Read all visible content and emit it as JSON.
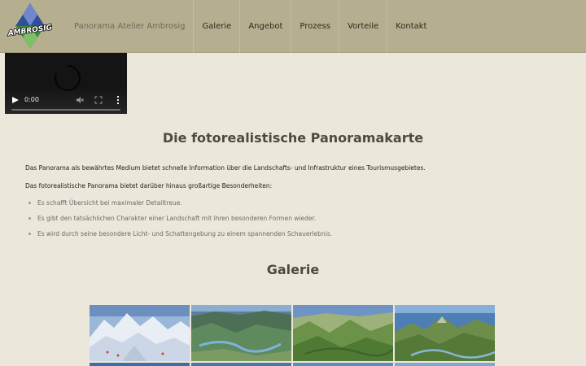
{
  "header": {
    "logo_text": "AMBROSIG",
    "nav": [
      "Panorama Atelier Ambrosig",
      "Galerie",
      "Angebot",
      "Prozess",
      "Vorteile",
      "Kontakt"
    ]
  },
  "video": {
    "time": "0:00",
    "state": "loading"
  },
  "main": {
    "title": "Die fotorealistische Panoramakarte",
    "paragraph1": "Das Panorama als bewährtes Medium bietet schnelle Information über die Landschafts- und Infrastruktur eines Tourismusgebietes.",
    "paragraph2": "Das fotorealistische Panorama bietet darüber hinaus großartige Besonderheiten:",
    "bullets": [
      "Es schafft Übersicht bei maximaler Detailtreue.",
      "Es gibt den tatsächlichen Charakter einer Landschaft mit ihren besonderen Formen wieder.",
      "Es wird durch seine besondere Licht- und Schattengebung zu einem spannenden Schauerlebnis."
    ]
  },
  "gallery": {
    "title": "Galerie",
    "images": [
      "snowy-alpine-panorama",
      "forested-valley-panorama",
      "green-hills-panorama",
      "mountain-ridge-panorama"
    ]
  },
  "colors": {
    "header_bg": "#b5ae8f",
    "page_bg": "#ece7db",
    "title_color": "#4e4a3c",
    "logo_blue": "#2f4f9b",
    "logo_green": "#3e8a3a"
  }
}
